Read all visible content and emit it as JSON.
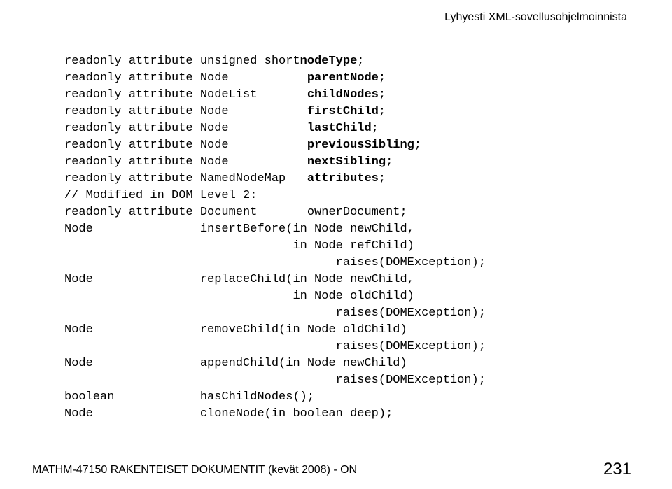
{
  "header": {
    "title": "Lyhyesti XML-sovellusohjelmoinnista"
  },
  "code": {
    "lines": [
      {
        "t1": "readonly attribute unsigned short",
        "kw": "nodeType",
        "t2": ";",
        "col": 37
      },
      {
        "t1": "readonly attribute Node           ",
        "kw": "parentNode",
        "t2": ";"
      },
      {
        "t1": "readonly attribute NodeList       ",
        "kw": "childNodes",
        "t2": ";"
      },
      {
        "t1": "readonly attribute Node           ",
        "kw": "firstChild",
        "t2": ";"
      },
      {
        "t1": "readonly attribute Node           ",
        "kw": "lastChild",
        "t2": ";"
      },
      {
        "t1": "readonly attribute Node           ",
        "kw": "previousSibling",
        "t2": ";"
      },
      {
        "t1": "readonly attribute Node           ",
        "kw": "nextSibling",
        "t2": ";"
      },
      {
        "t1": "readonly attribute NamedNodeMap   ",
        "kw": "attributes",
        "t2": ";"
      },
      {
        "t1": "// Modified in DOM Level 2:"
      },
      {
        "t1": "readonly attribute Document       ownerDocument;"
      },
      {
        "t1": "Node               insertBefore(in Node newChild,"
      },
      {
        "t1": "                                in Node refChild)"
      },
      {
        "t1": "                                      raises(DOMException);"
      },
      {
        "t1": "Node               replaceChild(in Node newChild,"
      },
      {
        "t1": "                                in Node oldChild)"
      },
      {
        "t1": "                                      raises(DOMException);"
      },
      {
        "t1": "Node               removeChild(in Node oldChild)"
      },
      {
        "t1": "                                      raises(DOMException);"
      },
      {
        "t1": "Node               appendChild(in Node newChild)"
      },
      {
        "t1": "                                      raises(DOMException);"
      },
      {
        "t1": "boolean            hasChildNodes();"
      },
      {
        "t1": "Node               cloneNode(in boolean deep);"
      }
    ]
  },
  "footer": {
    "course": "MATHM-47150 RAKENTEISET DOKUMENTIT (kevät 2008) - ON",
    "page": "231"
  }
}
